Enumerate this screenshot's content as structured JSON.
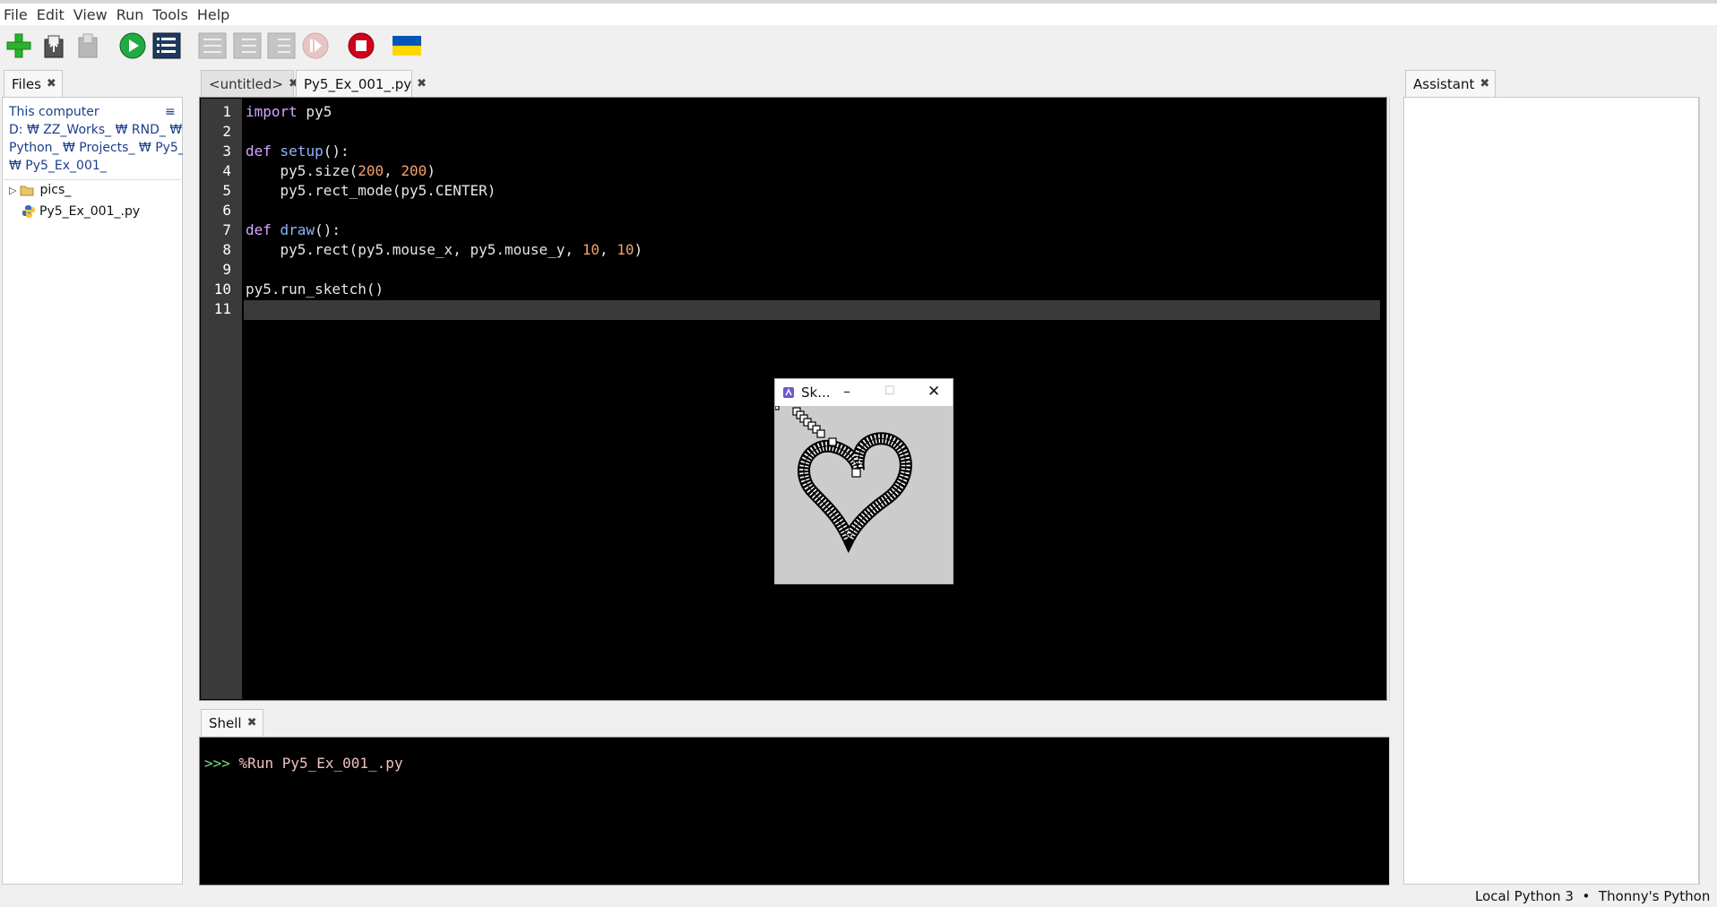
{
  "menu": [
    "File",
    "Edit",
    "View",
    "Run",
    "Tools",
    "Help"
  ],
  "toolbar": {
    "icons": [
      "new-file-icon",
      "open-file-icon",
      "save-file-icon",
      "run-icon",
      "debug-icon",
      "step-over-icon",
      "step-into-icon",
      "step-out-icon",
      "resume-icon",
      "stop-icon",
      "ukraine-flag-icon"
    ],
    "colors": {
      "run": "#22aa44",
      "stop": "#d0021b",
      "new": "#2cb22c",
      "flag_blue": "#0057b7",
      "flag_yellow": "#ffd700"
    }
  },
  "files": {
    "tab_label": "Files",
    "location_label": "This computer",
    "path_lines": [
      "D: ₩ ZZ_Works_ ₩ RND_ ₩",
      "Python_ ₩ Projects_ ₩ Py5_",
      "₩ Py5_Ex_001_"
    ],
    "tree": [
      {
        "name": "pics_",
        "type": "folder"
      },
      {
        "name": "Py5_Ex_001_.py",
        "type": "python-file"
      }
    ]
  },
  "editor": {
    "tabs": [
      {
        "label": "<untitled>",
        "active": false
      },
      {
        "label": "Py5_Ex_001_.py",
        "active": true
      }
    ],
    "line_numbers": [
      "1",
      "2",
      "3",
      "4",
      "5",
      "6",
      "7",
      "8",
      "9",
      "10",
      "11"
    ],
    "code": {
      "l1_kw": "import",
      "l1_rest": " py5",
      "l3_kw": "def",
      "l3_fn": " setup",
      "l3_rest": "():",
      "l4_a": "    py5.size(",
      "l4_n1": "200",
      "l4_b": ", ",
      "l4_n2": "200",
      "l4_c": ")",
      "l5": "    py5.rect_mode(py5.CENTER)",
      "l7_kw": "def",
      "l7_fn": " draw",
      "l7_rest": "():",
      "l8_a": "    py5.rect(py5.mouse_x, py5.mouse_y, ",
      "l8_n1": "10",
      "l8_b": ", ",
      "l8_n2": "10",
      "l8_c": ")",
      "l10": "py5.run_sketch()"
    }
  },
  "shell": {
    "tab_label": "Shell",
    "prompt": ">>>",
    "command": "%Run Py5_Ex_001_.py",
    "colors": {
      "prompt": "#7ee07e",
      "command": "#f2c0c0"
    }
  },
  "assistant": {
    "tab_label": "Assistant"
  },
  "sketch_window": {
    "title": "Sk...",
    "icons": [
      "app-icon",
      "minimize-icon",
      "maximize-icon",
      "close-icon"
    ]
  },
  "status": {
    "interpreter": "Local Python 3",
    "separator": "•",
    "name": "Thonny's Python",
    "menu_icon": "hamburger-icon"
  }
}
